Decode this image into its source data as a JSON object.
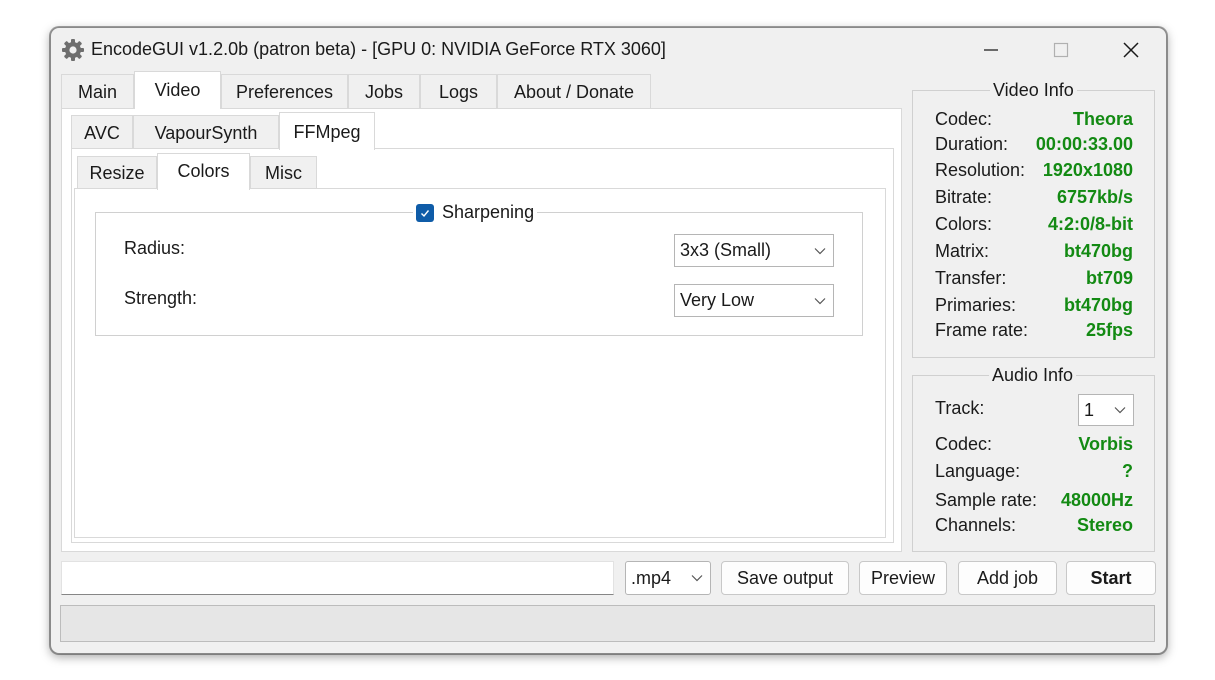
{
  "window": {
    "title": "EncodeGUI v1.2.0b (patron beta) - [GPU 0: NVIDIA GeForce RTX 3060]",
    "icon": "gear-icon"
  },
  "main_tabs": [
    "Main",
    "Video",
    "Preferences",
    "Jobs",
    "Logs",
    "About / Donate"
  ],
  "main_tab_selected": "Video",
  "video_tabs": [
    "AVC",
    "VapourSynth",
    "FFMpeg"
  ],
  "video_tab_selected": "FFMpeg",
  "ffmpeg_tabs": [
    "Resize",
    "Colors",
    "Misc"
  ],
  "ffmpeg_tab_selected": "Colors",
  "sharpening": {
    "label": "Sharpening",
    "checked": true,
    "radius_label": "Radius:",
    "radius_value": "3x3 (Small)",
    "strength_label": "Strength:",
    "strength_value": "Very Low"
  },
  "video_info": {
    "title": "Video Info",
    "rows": [
      {
        "label": "Codec:",
        "value": "Theora"
      },
      {
        "label": "Duration:",
        "value": "00:00:33.00"
      },
      {
        "label": "Resolution:",
        "value": "1920x1080"
      },
      {
        "label": "Bitrate:",
        "value": "6757kb/s"
      },
      {
        "label": "Colors:",
        "value": "4:2:0/8-bit"
      },
      {
        "label": "Matrix:",
        "value": "bt470bg"
      },
      {
        "label": "Transfer:",
        "value": "bt709"
      },
      {
        "label": "Primaries:",
        "value": "bt470bg"
      },
      {
        "label": "Frame rate:",
        "value": "25fps"
      }
    ]
  },
  "audio_info": {
    "title": "Audio Info",
    "track_label": "Track:",
    "track_value": "1",
    "rows": [
      {
        "label": "Codec:",
        "value": "Vorbis"
      },
      {
        "label": "Language:",
        "value": "?"
      },
      {
        "label": "Sample rate:",
        "value": "48000Hz"
      },
      {
        "label": "Channels:",
        "value": "Stereo"
      }
    ]
  },
  "bottom": {
    "output_path": "",
    "container": ".mp4",
    "save_output": "Save output",
    "preview": "Preview",
    "add_job": "Add job",
    "start": "Start"
  },
  "colors": {
    "value_green": "#138a13",
    "checkbox_blue": "#0f5ca8",
    "window_bg": "#f0f0f0"
  }
}
